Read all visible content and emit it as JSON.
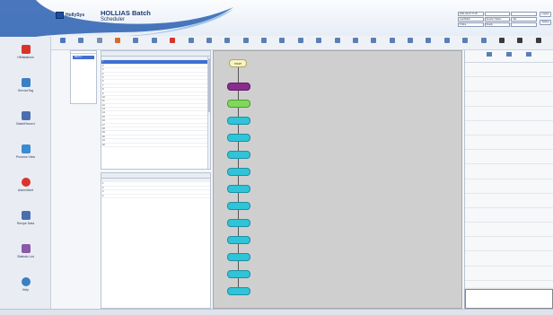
{
  "header": {
    "brand": "HollySys",
    "title": "HOLLIAS Batch",
    "subtitle": "Scheduler",
    "info_cells": [
      "2021-09-15 17:25",
      "",
      "",
      "Last Batch",
      "Session Status",
      "Idle",
      "Online",
      "Ready",
      ""
    ],
    "login_label": "Logout",
    "settings_label": "Setting"
  },
  "sidebar": {
    "items": [
      {
        "label": "HMIstations",
        "icon": "bar-chart-icon",
        "color": "#d9342b"
      },
      {
        "label": "ServiceTag",
        "icon": "document-icon",
        "color": "#3b7fc4"
      },
      {
        "label": "BatchRecord",
        "icon": "clipboard-icon",
        "color": "#4a6fae"
      },
      {
        "label": "Process View",
        "icon": "monitor-icon",
        "color": "#3b8bd0"
      },
      {
        "label": "Alarm/Alert",
        "icon": "alarm-icon",
        "color": "#d9342b"
      },
      {
        "label": "Recipe Data",
        "icon": "search-icon",
        "color": "#4a6fae"
      },
      {
        "label": "Statistic List",
        "icon": "pie-chart-icon",
        "color": "#8a5aa8"
      },
      {
        "label": "Help",
        "icon": "info-icon",
        "color": "#3b7fc4"
      }
    ]
  },
  "toolbar": {
    "buttons": [
      {
        "label": "",
        "color": "#4a78c2",
        "icon": "home-icon"
      },
      {
        "label": "",
        "color": "#5b7fb5",
        "icon": "grid-icon"
      },
      {
        "label": "",
        "color": "#7a8fb0",
        "icon": "list-icon"
      },
      {
        "label": "",
        "color": "#d86a2a",
        "icon": "edit-icon"
      },
      {
        "label": "",
        "color": "#5b7fb5",
        "icon": "copy-icon"
      },
      {
        "label": "",
        "color": "#5b7fb5",
        "icon": "save-icon"
      },
      {
        "label": "",
        "color": "#d9342b",
        "icon": "stop-icon"
      },
      {
        "label": "",
        "color": "#5b7fb5",
        "icon": "refresh-icon"
      },
      {
        "label": "",
        "color": "#5b7fb5",
        "icon": "step-icon"
      },
      {
        "label": "",
        "color": "#5b7fb5",
        "icon": "run-icon"
      },
      {
        "label": "",
        "color": "#5b7fb5",
        "icon": "pause-icon"
      },
      {
        "label": "",
        "color": "#5b7fb5",
        "icon": "resume-icon"
      },
      {
        "label": "",
        "color": "#5b7fb5",
        "icon": "abort-icon"
      },
      {
        "label": "",
        "color": "#5b7fb5",
        "icon": "hold-icon"
      },
      {
        "label": "",
        "color": "#5b7fb5",
        "icon": "restart-icon"
      },
      {
        "label": "",
        "color": "#5b7fb5",
        "icon": "reset-icon"
      },
      {
        "label": "",
        "color": "#5b7fb5",
        "icon": "acquire-icon"
      },
      {
        "label": "",
        "color": "#5b7fb5",
        "icon": "release-icon"
      },
      {
        "label": "",
        "color": "#5b7fb5",
        "icon": "message-icon"
      },
      {
        "label": "",
        "color": "#5b7fb5",
        "icon": "prompt-icon"
      },
      {
        "label": "",
        "color": "#5b7fb5",
        "icon": "batch-icon"
      },
      {
        "label": "",
        "color": "#5b7fb5",
        "icon": "phase-icon"
      },
      {
        "label": "",
        "color": "#5b7fb5",
        "icon": "unit-icon"
      },
      {
        "label": "",
        "color": "#5b7fb5",
        "icon": "recipe-icon"
      },
      {
        "label": "",
        "color": "#3a3a3a",
        "icon": "settings-icon"
      },
      {
        "label": "",
        "color": "#3a3a3a",
        "icon": "user-icon"
      },
      {
        "label": "",
        "color": "#3a3a3a",
        "icon": "exit-icon"
      }
    ]
  },
  "tree": {
    "header": "",
    "selected": "Batch 1"
  },
  "tasklist": {
    "title": "",
    "columns": [
      "",
      "",
      "",
      "",
      ""
    ],
    "rows": [
      [
        "1",
        "",
        "",
        "",
        ""
      ],
      [
        "2",
        "",
        "",
        "",
        ""
      ],
      [
        "3",
        "",
        "",
        "",
        ""
      ],
      [
        "4",
        "",
        "",
        "",
        ""
      ],
      [
        "5",
        "",
        "",
        "",
        ""
      ],
      [
        "6",
        "",
        "",
        "",
        ""
      ],
      [
        "7",
        "",
        "",
        "",
        ""
      ],
      [
        "8",
        "",
        "",
        "",
        ""
      ],
      [
        "9",
        "",
        "",
        "",
        ""
      ],
      [
        "10",
        "",
        "",
        "",
        ""
      ],
      [
        "11",
        "",
        "",
        "",
        ""
      ],
      [
        "12",
        "",
        "",
        "",
        ""
      ],
      [
        "13",
        "",
        "",
        "",
        ""
      ],
      [
        "14",
        "",
        "",
        "",
        ""
      ],
      [
        "15",
        "",
        "",
        "",
        ""
      ],
      [
        "16",
        "",
        "",
        "",
        ""
      ],
      [
        "17",
        "",
        "",
        "",
        ""
      ],
      [
        "18",
        "",
        "",
        "",
        ""
      ],
      [
        "19",
        "",
        "",
        "",
        ""
      ],
      [
        "20",
        "",
        "",
        "",
        ""
      ],
      [
        "21",
        "",
        "",
        "",
        ""
      ],
      [
        "22",
        "",
        "",
        "",
        ""
      ]
    ]
  },
  "params": {
    "title": "",
    "columns": [
      "",
      "",
      "",
      "",
      ""
    ],
    "rows": [
      [
        "1",
        "",
        "",
        "",
        ""
      ],
      [
        "2",
        "",
        "",
        "",
        ""
      ],
      [
        "3",
        "",
        "",
        "",
        ""
      ],
      [
        "4",
        "",
        "",
        "",
        ""
      ]
    ]
  },
  "canvas": {
    "start_label": "START",
    "nodes": [
      {
        "label": "",
        "color": "#8a2c8f"
      },
      {
        "label": "",
        "color": "#7fd85a"
      },
      {
        "label": "",
        "color": "#2fc4d8"
      },
      {
        "label": "",
        "color": "#2fc4d8"
      },
      {
        "label": "",
        "color": "#2fc4d8"
      },
      {
        "label": "",
        "color": "#2fc4d8"
      },
      {
        "label": "",
        "color": "#2fc4d8"
      },
      {
        "label": "",
        "color": "#2fc4d8"
      },
      {
        "label": "",
        "color": "#2fc4d8"
      },
      {
        "label": "",
        "color": "#2fc4d8"
      },
      {
        "label": "",
        "color": "#2fc4d8"
      },
      {
        "label": "",
        "color": "#2fc4d8"
      },
      {
        "label": "",
        "color": "#2fc4d8"
      }
    ]
  },
  "props": {
    "top_icons": [
      "",
      "",
      ""
    ],
    "rows": [
      {
        "key": "",
        "value": ""
      },
      {
        "key": "",
        "value": ""
      },
      {
        "key": "",
        "value": ""
      },
      {
        "key": "",
        "value": ""
      },
      {
        "key": "",
        "value": ""
      },
      {
        "key": "",
        "value": ""
      },
      {
        "key": "",
        "value": ""
      },
      {
        "key": "",
        "value": ""
      },
      {
        "key": "",
        "value": ""
      },
      {
        "key": "",
        "value": ""
      },
      {
        "key": "",
        "value": ""
      },
      {
        "key": "",
        "value": ""
      },
      {
        "key": "",
        "value": ""
      },
      {
        "key": "",
        "value": ""
      },
      {
        "key": "",
        "value": ""
      },
      {
        "key": "",
        "value": ""
      }
    ]
  },
  "popup": {
    "lines": [
      "",
      "",
      ""
    ]
  },
  "statusbar": {
    "left": "",
    "center": "",
    "right": ""
  }
}
